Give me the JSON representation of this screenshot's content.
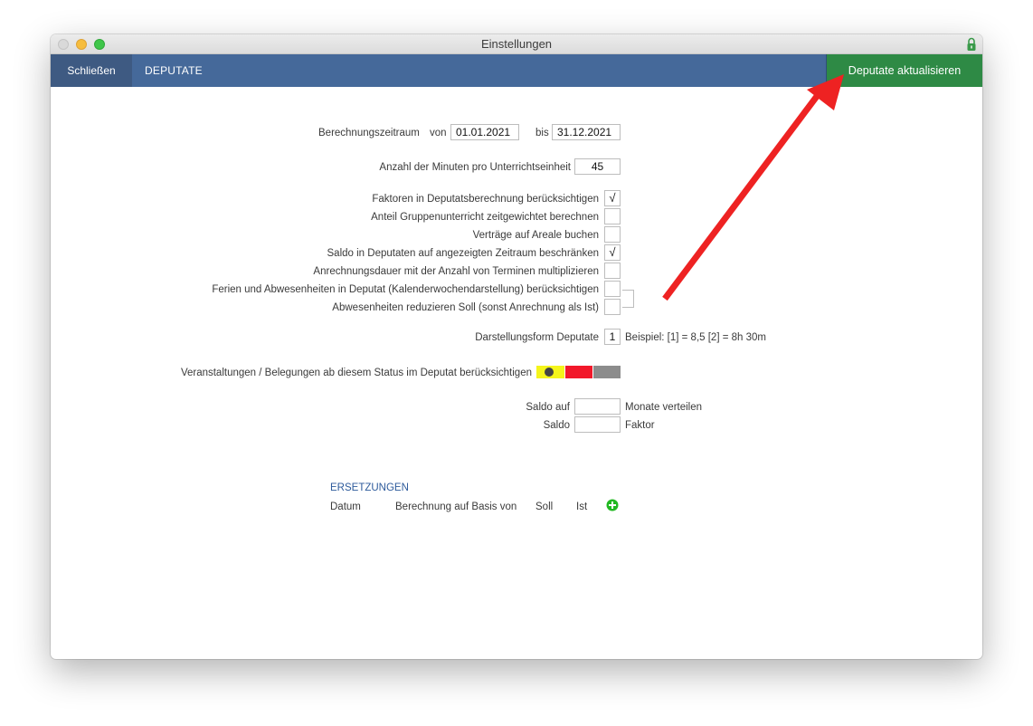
{
  "window": {
    "title": "Einstellungen"
  },
  "toolbar": {
    "close_label": "Schließen",
    "tab_label": "DEPUTATE",
    "update_label": "Deputate aktualisieren"
  },
  "form": {
    "period": {
      "label": "Berechnungszeitraum",
      "from_label": "von",
      "from_value": "01.01.2021",
      "to_label": "bis",
      "to_value": "31.12.2021"
    },
    "minutes": {
      "label": "Anzahl der Minuten pro Unterrichtseinheit",
      "value": "45"
    },
    "checkboxes": [
      {
        "label": "Faktoren in Deputatsberechnung berücksichtigen",
        "mark": "√"
      },
      {
        "label": "Anteil Gruppenunterricht zeitgewichtet berechnen",
        "mark": ""
      },
      {
        "label": "Verträge auf Areale buchen",
        "mark": ""
      },
      {
        "label": "Saldo in Deputaten auf angezeigten Zeitraum beschränken",
        "mark": "√"
      },
      {
        "label": "Anrechnungsdauer mit der Anzahl von Terminen multiplizieren",
        "mark": ""
      },
      {
        "label": "Ferien und Abwesenheiten in Deputat (Kalenderwochendarstellung) berücksichtigen",
        "mark": ""
      },
      {
        "label": "Abwesenheiten reduzieren Soll (sonst Anrechnung als Ist)",
        "mark": ""
      }
    ],
    "display": {
      "label": "Darstellungsform Deputate",
      "value": "1",
      "example": "Beispiel:   [1] = 8,5    [2] = 8h 30m"
    },
    "status": {
      "label": "Veranstaltungen / Belegungen ab diesem Status im Deputat berücksichtigen",
      "colors": [
        "#f5f51b",
        "#f2182a",
        "#8c8c8c"
      ]
    },
    "saldo_auf": {
      "label": "Saldo auf",
      "value": "",
      "suffix": "Monate verteilen"
    },
    "saldo": {
      "label": "Saldo",
      "value": "",
      "suffix": "Faktor"
    }
  },
  "ersetzungen": {
    "title": "ERSETZUNGEN",
    "columns": [
      "Datum",
      "Berechnung auf Basis von",
      "Soll",
      "Ist"
    ]
  },
  "colors": {
    "toolbar": "#45699a",
    "update_button": "#2e8a45",
    "arrow": "#ee2222",
    "add_icon": "#22b822"
  },
  "icons": {
    "lock": "lock-icon",
    "add": "plus-circle-icon",
    "pointer": "red-arrow"
  }
}
